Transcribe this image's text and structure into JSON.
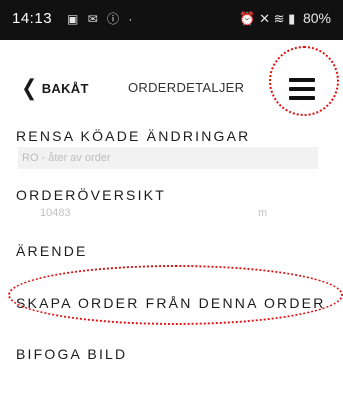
{
  "status_bar": {
    "time": "14:13",
    "left_icons": "▣ ✉ ⓘ ·",
    "right_icons": "⏰ ✕ ≋ ▮",
    "battery": "80%"
  },
  "header": {
    "back_label": "BAKÅT",
    "title": "ORDERDETALJER"
  },
  "menu": {
    "items": [
      "RENSA KÖADE ÄNDRINGAR",
      "ORDERÖVERSIKT",
      "ÄRENDE",
      "SKAPA ORDER FRÅN DENNA ORDER",
      "BIFOGA BILD"
    ]
  },
  "background": {
    "field_placeholder": "RO - åter av order",
    "value_1": "10483",
    "value_2": "m"
  },
  "colors": {
    "annotation": "#e01010",
    "status_bar": "#111111"
  }
}
